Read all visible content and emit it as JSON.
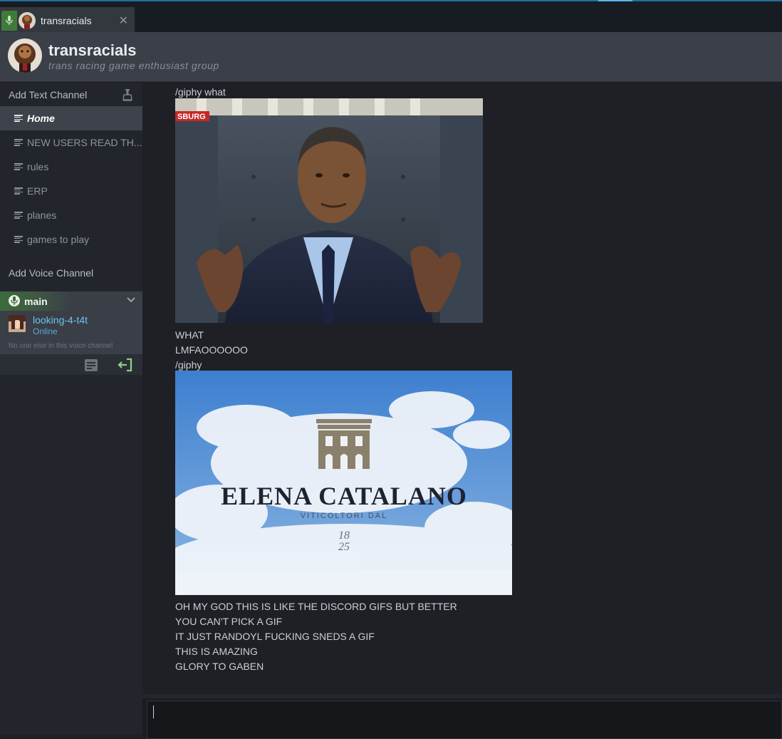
{
  "tab": {
    "title": "transracials",
    "close": "✕",
    "mic_icon": "mic-icon"
  },
  "header": {
    "name": "transracials",
    "tagline": "trans racing game enthusiast group"
  },
  "sidebar": {
    "add_text_channel": "Add Text Channel",
    "channels": [
      {
        "label": "Home",
        "active": true
      },
      {
        "label": "NEW USERS READ TH..."
      },
      {
        "label": "rules"
      },
      {
        "label": "ERP"
      },
      {
        "label": "planes"
      },
      {
        "label": "games to play"
      }
    ],
    "add_voice_channel": "Add Voice Channel",
    "voice": {
      "name": "main",
      "user": "looking-4-t4t",
      "status": "Online",
      "empty_note": "No one else in this voice channel"
    }
  },
  "messages": [
    "/giphy what",
    "WHAT",
    "LMFAOOOOOO",
    "/giphy",
    "OH MY GOD THIS IS LIKE THE DISCORD GIFS BUT BETTER",
    "YOU CAN'T PICK A GIF",
    "IT JUST RANDOYL FUCKING SNEDS A GIF",
    "THIS IS AMAZING",
    "GLORY TO GABEN"
  ],
  "gifs": {
    "first": {
      "badge": "SBURG"
    },
    "second": {
      "brand": "ELENA CATALANO",
      "sub": "VITICOLTORI DAL",
      "year_top": "18",
      "year_bottom": "25"
    }
  },
  "colors": {
    "accent_blue": "#5ab4f0",
    "voice_green": "#3d6b3b",
    "online_blue": "#6cc3f0"
  }
}
